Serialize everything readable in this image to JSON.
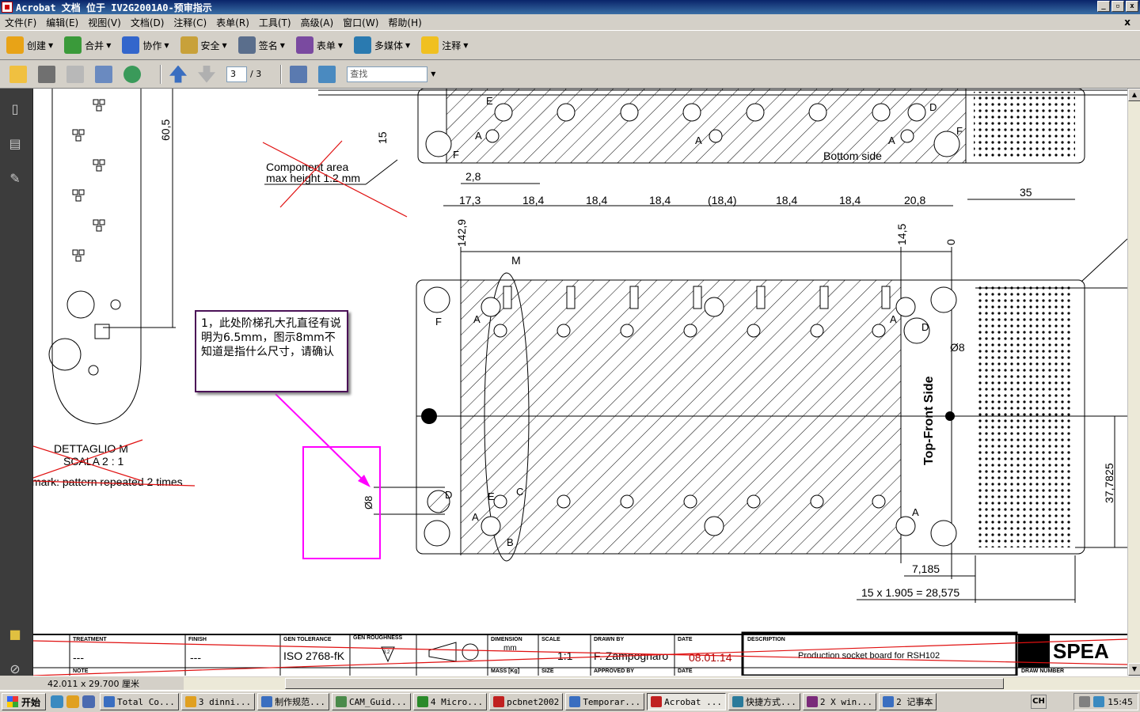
{
  "window": {
    "title": "Acrobat 文档 位于 IV2G2001A0-预审指示",
    "btn_minimize": "_",
    "btn_restore": "▫",
    "btn_close": "x"
  },
  "menu": [
    {
      "label": "文件(F)"
    },
    {
      "label": "编辑(E)"
    },
    {
      "label": "视图(V)"
    },
    {
      "label": "文档(D)"
    },
    {
      "label": "注释(C)"
    },
    {
      "label": "表单(R)"
    },
    {
      "label": "工具(T)"
    },
    {
      "label": "高级(A)"
    },
    {
      "label": "窗口(W)"
    },
    {
      "label": "帮助(H)"
    }
  ],
  "menu_close": "x",
  "toolbar1": [
    {
      "label": "创建",
      "icon": "create-icon",
      "color": "#e8a317"
    },
    {
      "label": "合并",
      "icon": "combine-icon",
      "color": "#3a9a3a"
    },
    {
      "label": "协作",
      "icon": "collaborate-icon",
      "color": "#3366cc"
    },
    {
      "label": "安全",
      "icon": "lock-icon",
      "color": "#c8a13a"
    },
    {
      "label": "签名",
      "icon": "pen-icon",
      "color": "#5a6e8c"
    },
    {
      "label": "表单",
      "icon": "form-icon",
      "color": "#7a4aa0"
    },
    {
      "label": "多媒体",
      "icon": "multimedia-icon",
      "color": "#2a7ab0"
    },
    {
      "label": "注释",
      "icon": "comment-icon",
      "color": "#f0c020"
    }
  ],
  "toolbar2": {
    "page_current": "3",
    "page_total": "/ 3",
    "find_placeholder": "查找"
  },
  "drawing": {
    "detail_label": "DETTAGLIO M",
    "detail_scale": "SCALA 2 : 1",
    "remark": "mark: pattern repeated 2 times",
    "component_area_1": "Component area",
    "component_area_2": "max height 1.2 mm",
    "bottom_side": "Bottom side",
    "top_front_side": "Top-Front Side",
    "dims_top": [
      "17,3",
      "18,4",
      "18,4",
      "18,4",
      "(18,4)",
      "18,4",
      "18,4",
      "20,8"
    ],
    "dim_2_8": "2,8",
    "dim_35": "35",
    "dim_15": "15",
    "dim_60_5": "60,5",
    "dim_142_9": "142,9",
    "dim_14_5": "14,5",
    "dim_0": "0",
    "dim_M": "M",
    "dim_phi8_right": "Ø8",
    "dim_phi8_left": "Ø8",
    "dim_37_7825": "37,7825",
    "dim_7_185": "7,185",
    "dim_pitch": "15 x 1.905 = 28,575",
    "hole_labels": {
      "A": "A",
      "B": "B",
      "C": "C",
      "D": "D",
      "E": "E",
      "F": "F"
    }
  },
  "annotation_note": "1，此处阶梯孔大孔直径有说明为6.5mm，图示8mm不知道是指什么尺寸，请确认",
  "title_block": {
    "treatment_h": "TREATMENT",
    "treatment_v": "---",
    "finish_h": "FINISH",
    "finish_v": "---",
    "gen_tol_h": "GEN TOLERANCE",
    "gen_tol_v": "ISO 2768-fK",
    "gen_rough_h": "GEN ROUGHNESS",
    "gen_rough_v": "3.2",
    "dimension_h": "DIMENSION",
    "dimension_v": "mm",
    "scale_h": "SCALE",
    "scale_v": "1:1",
    "drawn_h": "DRAWN BY",
    "drawn_v": "F. Zampognaro",
    "date_h": "DATE",
    "date_v": "08.01.14",
    "desc_h": "DESCRIPTION",
    "desc_v": "Production socket board for RSH102",
    "note_h": "NOTE",
    "mass_h": "MASS [Kg]",
    "size_h": "SIZE",
    "approved_h": "APPROVED BY",
    "date2_h": "DATE",
    "drawnum_h": "DRAW NUMBER",
    "logo": "SPEA"
  },
  "statusbar": {
    "page_size": "42.011 x 29.700 厘米"
  },
  "taskbar": {
    "start": "开始",
    "tasks": [
      {
        "label": "Total Co...",
        "color": "#3a6ec0"
      },
      {
        "label": "3 dinni...",
        "color": "#e0a020"
      },
      {
        "label": "制作规范...",
        "color": "#3a6ec0"
      },
      {
        "label": "CAM_Guid...",
        "color": "#4a8a4a"
      },
      {
        "label": "4 Micro...",
        "color": "#2a8a2a"
      },
      {
        "label": "pcbnet2002",
        "color": "#c02020"
      },
      {
        "label": "Temporar...",
        "color": "#3a6ec0"
      },
      {
        "label": "Acrobat ...",
        "color": "#c02020",
        "active": true
      },
      {
        "label": "快捷方式...",
        "color": "#2a7a9a"
      },
      {
        "label": "2 X win...",
        "color": "#7a2a7a"
      },
      {
        "label": "2 记事本",
        "color": "#3a6ec0"
      }
    ],
    "ime": "CH",
    "clock": "15:45"
  },
  "colors": {
    "annotation_border": "#4b1257",
    "callout": "#ff00ff",
    "strike": "#e01010"
  }
}
